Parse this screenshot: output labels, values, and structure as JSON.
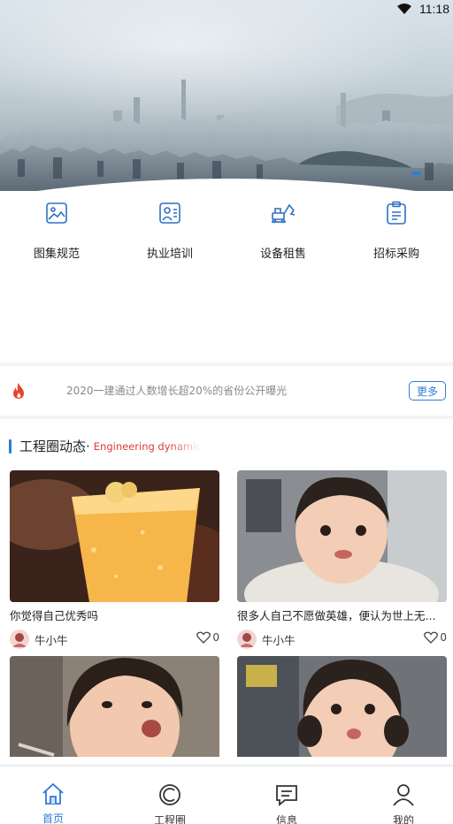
{
  "status_bar": {
    "time": "11:18"
  },
  "quick_menu": [
    {
      "label": "图集规范",
      "icon": "image-icon"
    },
    {
      "label": "执业培训",
      "icon": "training-icon"
    },
    {
      "label": "设备租售",
      "icon": "excavator-icon"
    },
    {
      "label": "招标采购",
      "icon": "clipboard-icon"
    }
  ],
  "notice": {
    "icon": "fire-icon",
    "text": "2020一建通过人数增长超20%的省份公开曝光",
    "more_label": "更多"
  },
  "section": {
    "title": "工程圈动态·",
    "subtitle": "Engineering dynamic"
  },
  "posts": [
    {
      "caption": "你觉得自己优秀吗",
      "author": "牛小牛",
      "likes": "0"
    },
    {
      "caption": "很多人自己不愿做英雄，便认为世上无...",
      "author": "牛小牛",
      "likes": "0"
    },
    {
      "caption": "",
      "author": "",
      "likes": ""
    },
    {
      "caption": "",
      "author": "",
      "likes": ""
    }
  ],
  "tabbar": [
    {
      "label": "首页",
      "icon": "home-icon",
      "active": true
    },
    {
      "label": "工程圈",
      "icon": "circle-icon",
      "active": false
    },
    {
      "label": "信息",
      "icon": "message-icon",
      "active": false
    },
    {
      "label": "我的",
      "icon": "user-icon",
      "active": false
    }
  ],
  "colors": {
    "accent": "#2e7bdb",
    "subtitle_red": "#e03a3a",
    "fire": "#e8452c"
  }
}
